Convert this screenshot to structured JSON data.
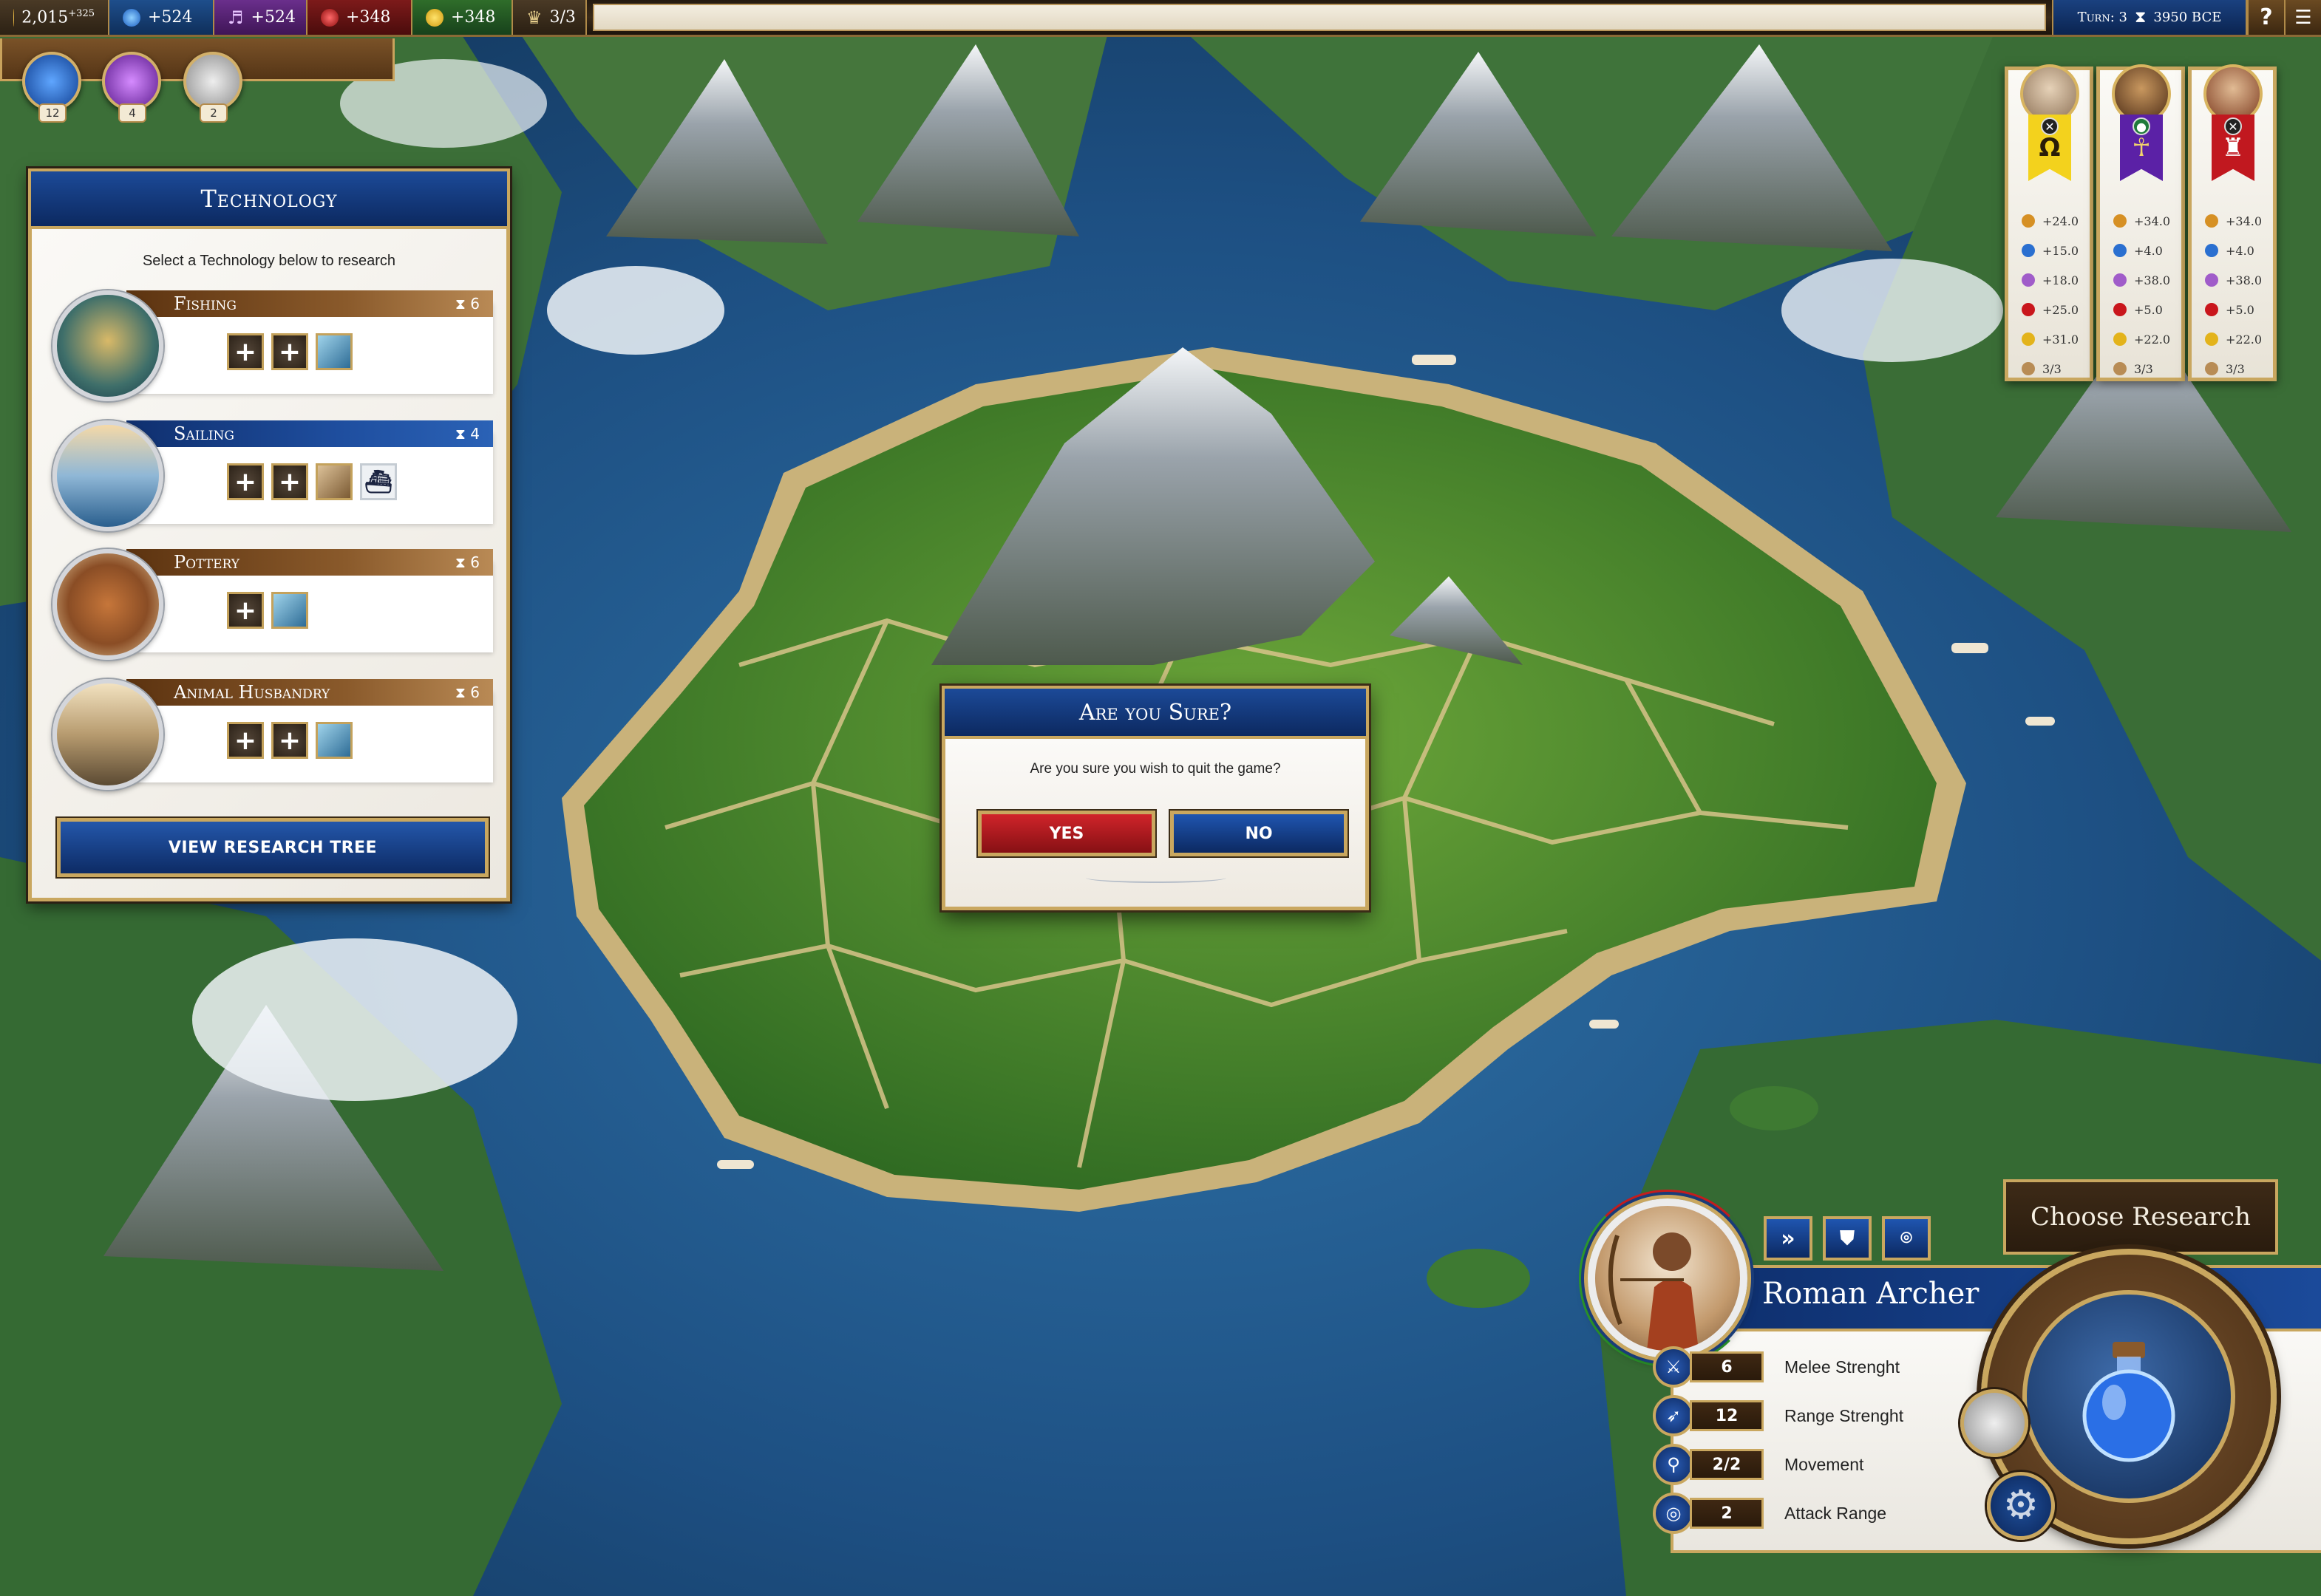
{
  "resources": {
    "gold": {
      "value": "2,015",
      "delta": "+325",
      "icon": "gold-coin-icon"
    },
    "science": {
      "value": "+524",
      "icon": "science-flask-icon"
    },
    "culture": {
      "value": "+524",
      "icon": "music-note-icon"
    },
    "faith": {
      "value": "+348",
      "icon": "faith-orb-icon"
    },
    "happiness": {
      "value": "+348",
      "icon": "smiley-icon"
    },
    "population": {
      "value": "3/3",
      "icon": "crown-icon"
    }
  },
  "turn": {
    "label": "Turn: 3",
    "year": "3950 BCE"
  },
  "system_buttons": {
    "help": "?",
    "menu": "☰"
  },
  "quick_icons": [
    {
      "name": "science",
      "count": "12"
    },
    {
      "name": "culture",
      "count": "4"
    },
    {
      "name": "great-person",
      "count": "2"
    }
  ],
  "technology": {
    "title": "Technology",
    "instruction": "Select a Technology below to research",
    "items": [
      {
        "name": "Fishing",
        "turns": "6",
        "theme": "brown",
        "unlocks": [
          "plus",
          "plus",
          "tile"
        ]
      },
      {
        "name": "Sailing",
        "turns": "4",
        "theme": "blue",
        "unlocks": [
          "plus",
          "plus",
          "tile2",
          "ship"
        ]
      },
      {
        "name": "Pottery",
        "turns": "6",
        "theme": "brown",
        "unlocks": [
          "plus",
          "tile"
        ]
      },
      {
        "name": "Animal Husbandry",
        "turns": "6",
        "theme": "brown",
        "unlocks": [
          "plus",
          "plus",
          "tile"
        ]
      }
    ],
    "button": "VIEW RESEARCH TREE"
  },
  "leaders": [
    {
      "symbol": "Ω",
      "banner_color": "#f3d21d",
      "symbol_color": "#2a1d08",
      "stats": [
        "+24.0",
        "+15.0",
        "+18.0",
        "+25.0",
        "+31.0",
        "3/3"
      ]
    },
    {
      "symbol": "☥",
      "banner_color": "#5b21a6",
      "symbol_color": "#f2d36b",
      "stats": [
        "+34.0",
        "+4.0",
        "+38.0",
        "+5.0",
        "+22.0",
        "3/3"
      ]
    },
    {
      "symbol": "♜",
      "banner_color": "#c1181f",
      "symbol_color": "#ffffff",
      "stats": [
        "+34.0",
        "+4.0",
        "+38.0",
        "+5.0",
        "+22.0",
        "3/3"
      ]
    }
  ],
  "stat_colors": [
    "#d69024",
    "#2a6fd0",
    "#a05cc9",
    "#c9161c",
    "#e3b31b",
    "#b88c55"
  ],
  "dialog": {
    "title": "Are you Sure?",
    "message": "Are you sure you wish to quit the game?",
    "yes": "YES",
    "no": "NO"
  },
  "unit": {
    "name": "Roman Archer",
    "actions": [
      "»",
      "⛊",
      "⌾"
    ],
    "stats": [
      {
        "icon": "sword-icon",
        "glyph": "⚔",
        "value": "6",
        "label": "Melee Strenght"
      },
      {
        "icon": "bow-icon",
        "glyph": "➶",
        "value": "12",
        "label": "Range Strenght"
      },
      {
        "icon": "footsteps-icon",
        "glyph": "⚲",
        "value": "2/2",
        "label": "Movement"
      },
      {
        "icon": "target-icon",
        "glyph": "◎",
        "value": "2",
        "label": "Attack Range"
      }
    ]
  },
  "research": {
    "title": "Choose Research"
  }
}
